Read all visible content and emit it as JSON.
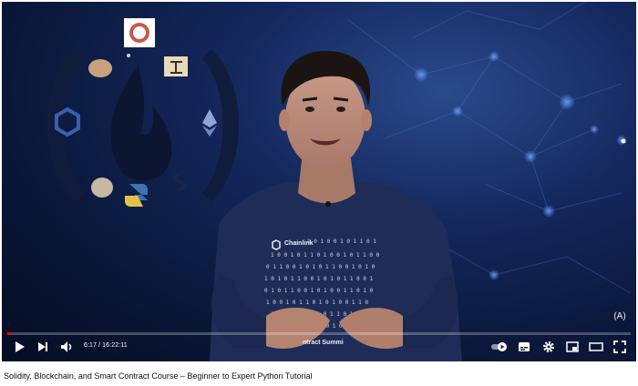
{
  "player": {
    "current_time": "6:17",
    "separator": " / ",
    "duration": "16:22:11",
    "progress_fraction": 0.0064
  },
  "video": {
    "title": "Solidity, Blockchain, and Smart Contract Course – Beginner to Expert Python Tutorial"
  },
  "overlay": {
    "shirt_brand": "Chainlink",
    "shirt_bottom_text": "ntract Summi",
    "watermark_glyph": "(A)"
  },
  "controls": {
    "left": [
      "play-icon",
      "next-icon",
      "volume-icon"
    ],
    "right": [
      "autoplay-toggle-icon",
      "subtitles-icon",
      "settings-gear-icon",
      "miniplayer-icon",
      "theater-mode-icon",
      "fullscreen-icon"
    ]
  },
  "colors": {
    "progress": "#ff0000",
    "background_dark": "#0a1738",
    "accent_blue": "#2a4a8c"
  }
}
